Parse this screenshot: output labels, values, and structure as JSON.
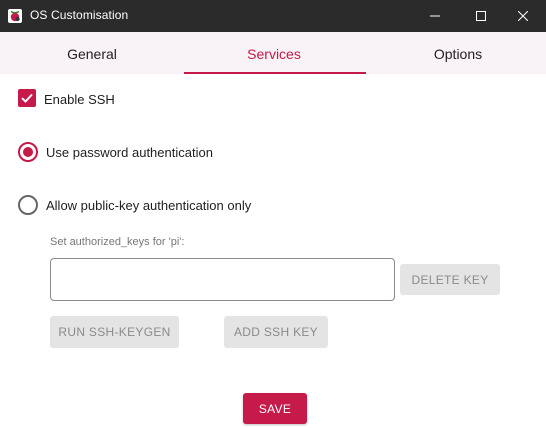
{
  "window": {
    "title": "OS Customisation",
    "controls": [
      "minimize-icon",
      "maximize-icon",
      "close-icon"
    ]
  },
  "tabs": [
    {
      "label": "General",
      "active": false
    },
    {
      "label": "Services",
      "active": true
    },
    {
      "label": "Options",
      "active": false
    }
  ],
  "services": {
    "enable_ssh": {
      "label": "Enable SSH",
      "checked": true
    },
    "auth_options": [
      {
        "label": "Use password authentication",
        "selected": true
      },
      {
        "label": "Allow public-key authentication only",
        "selected": false
      }
    ],
    "authorized_keys_label": "Set authorized_keys for 'pi':",
    "authorized_keys_value": "",
    "buttons": {
      "delete_key": "DELETE KEY",
      "run_keygen": "RUN SSH-KEYGEN",
      "add_key": "ADD SSH KEY"
    }
  },
  "save_label": "SAVE",
  "colors": {
    "accent": "#c51a4a",
    "titlebar": "#2b2b2b",
    "tab_background": "#f9f2f6",
    "disabled_button": "#e4e4e4"
  }
}
